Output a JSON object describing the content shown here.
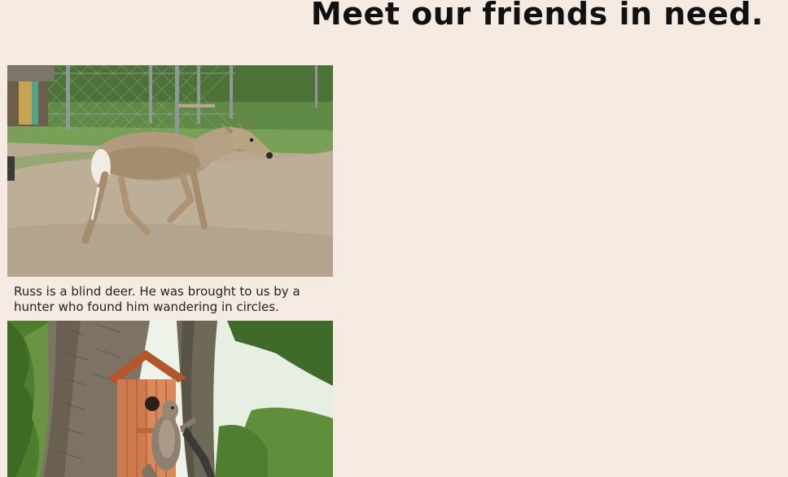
{
  "page": {
    "title": "Meet our friends in need."
  },
  "animals": [
    {
      "image_alt": "deer",
      "caption": "Russ is a blind deer. He was brought to us by a hunter who found him wandering in circles."
    },
    {
      "image_alt": "squirrel on birdhouse",
      "caption": ""
    }
  ]
}
